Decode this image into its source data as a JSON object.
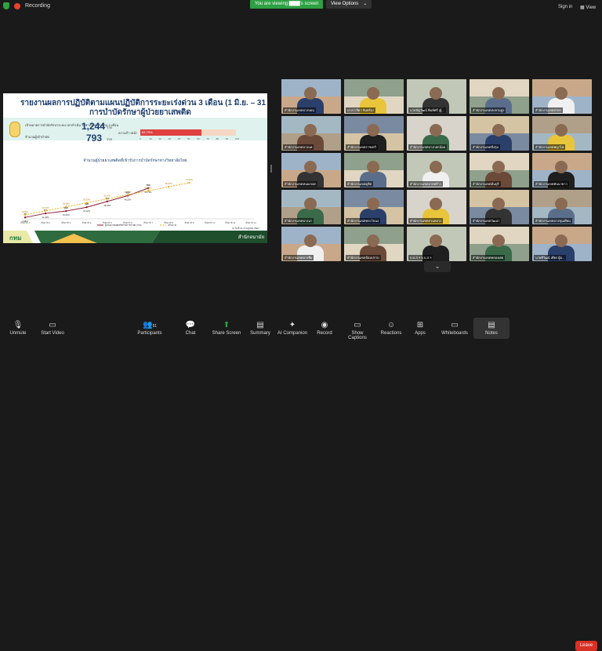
{
  "topbar": {
    "recording_label": "Recording",
    "viewing_banner": "You are viewing ▇▇▇'s screen",
    "view_options_label": "View Options",
    "view_options_caret": "⌄",
    "sign_in_label": "Sign in",
    "view_label": "View"
  },
  "slide": {
    "title_line1": "รายงานผลการปฏิบัติตามแผนปฏิบัติการระยะเร่งด่วน 3 เดือน (1 มิ.ย. – 31 ส.ค. 67)",
    "title_line2": "การบำบัดรักษาผู้ป่วยยาเสพติด",
    "target_label": "เป้าหมายการบำบัดรักษาระยะเวลาดำเนิน ในช่วงระยะเร่งด่วน 3 เดือน",
    "target_value": "1,244",
    "target_unit": "ราย",
    "treated_label": "จำนวนผู้เข้าบำบัด",
    "treated_value": "793",
    "treated_unit": "ราย",
    "progress_label": "ความก้าวหน้า",
    "progress_percent": 63.75,
    "progress_text": "63.75%",
    "axis_ticks": [
      "0",
      "10",
      "20",
      "30",
      "40",
      "50",
      "60",
      "70",
      "80",
      "90",
      "100"
    ],
    "chart_title": "จำนวนผู้ป่วยยาเสพติดที่เข้ารับการบำบัดรักษาทางวิทยาลัยไทย",
    "footer_logo": "กทม",
    "footer_org": "สำนักอนามัย",
    "note": "ณ วันที่ 31 กรกฎาคม 2567"
  },
  "chart_data": {
    "type": "line",
    "categories": [
      "สัปดาห์ 1",
      "สัปดาห์ 2",
      "สัปดาห์ 3",
      "สัปดาห์ 4",
      "สัปดาห์ 5",
      "สัปดาห์ 6",
      "สัปดาห์ 7",
      "สัปดาห์ 8",
      "สัปดาห์ 9",
      "สัปดาห์ 10",
      "สัปดาห์ 11",
      "สัปดาห์ 12"
    ],
    "series": [
      {
        "name": "ผู้ป่วยยาเสพติดที่เข้ารับการบำบัด (ราย)",
        "values": [
          37,
          141,
          202,
          300,
          450,
          600,
          793
        ],
        "labels": [
          "2.98%",
          "11.34%",
          "16.24%",
          "24.12%",
          "36.18%",
          "48.23%",
          "63.75%"
        ],
        "color": "#8b1a2b"
      },
      {
        "name": "เป้าหมาย",
        "values": [
          104,
          207,
          311,
          415,
          518,
          622,
          726,
          830,
          933
        ],
        "labels": [
          "8.33%",
          "16.67%",
          "25.00%",
          "33.33%",
          "41.67%",
          "50.00%",
          "58.33%",
          "66.67%",
          "75.00%"
        ],
        "color": "#f0b020"
      }
    ],
    "ylim": [
      0,
      1300
    ],
    "grid": false,
    "legend": "bottom"
  },
  "participants": [
    {
      "name": "สำนักงานเขตบางบอน"
    },
    {
      "name": "นางวาสิตา จันทร์เป"
    },
    {
      "name": "นายปัญวัฒน์ พิมพ์ศรี (ผู้..."
    },
    {
      "name": "สำนักงานเขตสะพานสูง"
    },
    {
      "name": "สำนักงานเขตสาทร"
    },
    {
      "name": "สำนักงานเขตบางแค"
    },
    {
      "name": "สำนักงานเขตราชเทวี"
    },
    {
      "name": "สำนักงานเขตบางกอกน้อย"
    },
    {
      "name": "สำนักงานเขตบึงกุ่ม"
    },
    {
      "name": "สำนักงานเขตพญาไท"
    },
    {
      "name": "สำนักงานเขตหนองจอก"
    },
    {
      "name": "สำนักงานเขตดุสิต"
    },
    {
      "name": "สำนักงานเขตลาดพร้าว"
    },
    {
      "name": "สำนักงานเขตมีนบุรี"
    },
    {
      "name": "สำนักงานเขตคันนายาว"
    },
    {
      "name": "สำนักงานเขตบางนา"
    },
    {
      "name": "สำนักงานเขตพระโขนง"
    },
    {
      "name": "สำนักงานเขตสวนหลวง"
    },
    {
      "name": "สำนักงานเขตวัฒนา"
    },
    {
      "name": "สำนักงานเขตบางขุนเทียน"
    },
    {
      "name": "สำนักงานเขตบางซื่อ"
    },
    {
      "name": "สำนักงานเขตป้อมปราบ"
    },
    {
      "name": "บ.บ.ส.ฯ บ.บ.ส.ฯ"
    },
    {
      "name": "สำนักงานเขตคลองเตย"
    },
    {
      "name": "นายศิวัฒน์ เพียร ผู้อ..."
    }
  ],
  "toolbar": {
    "unmute": "Unmute",
    "start_video": "Start Video",
    "participants": "Participants",
    "participants_count": "91",
    "chat": "Chat",
    "share_screen": "Share Screen",
    "summary": "Summary",
    "ai_companion": "AI Companion",
    "record": "Record",
    "show_captions": "Show Captions",
    "reactions": "Reactions",
    "apps": "Apps",
    "whiteboards": "Whiteboards",
    "notes": "Notes",
    "leave": "Leave"
  },
  "colors": {
    "share_green": "#2ea043",
    "leave_red": "#d93025",
    "slide_navy": "#1d3e6e"
  }
}
